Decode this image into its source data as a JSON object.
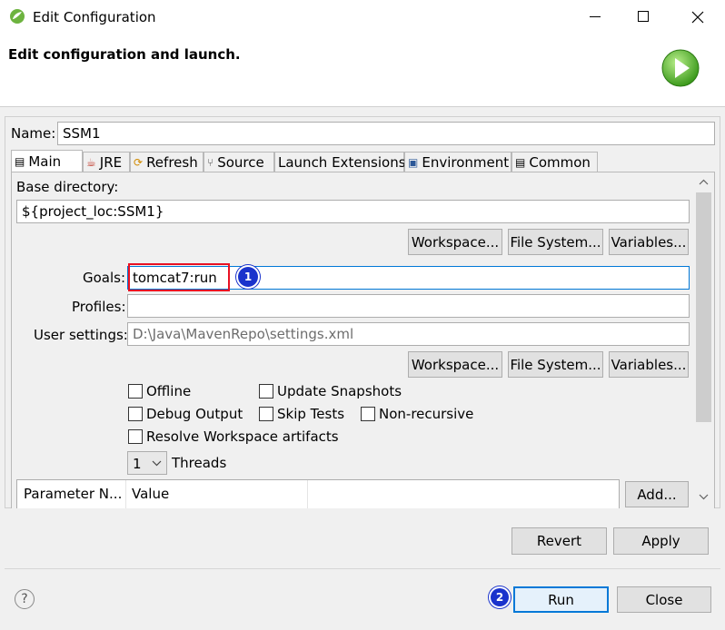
{
  "window": {
    "title": "Edit Configuration",
    "header_title": "Edit configuration and launch."
  },
  "name": {
    "label": "Name:",
    "value": "SSM1"
  },
  "tabs": [
    {
      "label": "Main",
      "icon": "main-tab-icon"
    },
    {
      "label": "JRE",
      "icon": "jre-icon"
    },
    {
      "label": "Refresh",
      "icon": "refresh-icon"
    },
    {
      "label": "Source",
      "icon": "source-icon"
    },
    {
      "label": "Launch Extensions",
      "icon": ""
    },
    {
      "label": "Environment",
      "icon": "environment-icon"
    },
    {
      "label": "Common",
      "icon": "common-icon"
    }
  ],
  "main": {
    "base_dir_label": "Base directory:",
    "base_dir_value": "${project_loc:SSM1}",
    "buttons": {
      "workspace": "Workspace...",
      "filesystem": "File System...",
      "variables": "Variables..."
    },
    "goals_label": "Goals:",
    "goals_value": "tomcat7:run",
    "profiles_label": "Profiles:",
    "profiles_value": "",
    "user_settings_label": "User settings:",
    "user_settings_value": "D:\\Java\\MavenRepo\\settings.xml",
    "checkboxes": {
      "offline": "Offline",
      "update_snapshots": "Update Snapshots",
      "debug_output": "Debug Output",
      "skip_tests": "Skip Tests",
      "non_recursive": "Non-recursive",
      "resolve_workspace": "Resolve Workspace artifacts"
    },
    "threads_value": "1",
    "threads_label": "Threads",
    "table_headers": [
      "Parameter N...",
      "Value"
    ],
    "add_button": "Add..."
  },
  "annotations": {
    "goals_marker": "1",
    "run_marker": "2"
  },
  "bottom": {
    "revert": "Revert",
    "apply": "Apply",
    "run": "Run",
    "close": "Close",
    "help": "?"
  },
  "colors": {
    "highlight": "#e81123",
    "marker": "#1a33cc",
    "accent": "#0078d7",
    "play_green": "#4caf32"
  }
}
